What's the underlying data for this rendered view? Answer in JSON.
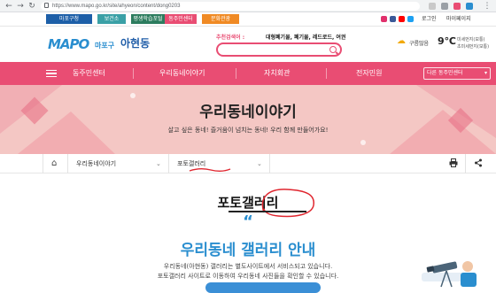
{
  "browser": {
    "url": "https://www.mapo.go.kr/site/ahyeon/content/dong0203"
  },
  "top_strip": {
    "tabs": [
      {
        "label": "마포구청",
        "color": "#1d5fa8"
      },
      {
        "label": "보건소",
        "color": "#3aa0a6"
      },
      {
        "label": "평생학습포털",
        "color": "#2c7c5e"
      },
      {
        "label": "동주민센터",
        "color": "#e94d73"
      },
      {
        "label": "문화관광",
        "color": "#f08a24"
      }
    ],
    "utility": [
      "로그인",
      "마이페이지"
    ]
  },
  "header": {
    "logo_mark": "MAPO",
    "logo_gu": "마포구",
    "logo_dong": "아현동",
    "recommend_label": "추천검색어 :",
    "recommend_words": "대형폐기물, 폐기물, 레드로드, 여권",
    "search_placeholder": "",
    "weather_state": "구름많음",
    "weather_temp": "9℃",
    "air_quality_1": "미세먼지(보통)",
    "air_quality_2": "초미세먼지(보통)"
  },
  "gnb": {
    "items": [
      "동주민센터",
      "우리동네이야기",
      "자치회관",
      "전자민원"
    ],
    "select_label": "다른 동주민센터"
  },
  "hero": {
    "title": "우리동네이야기",
    "subtitle": "살고 싶은 동네! 즐거움이 넘치는 동네! 우리 함께 만들어가요!"
  },
  "breadcrumb": {
    "items": [
      "우리동네이야기",
      "포토갤러리"
    ]
  },
  "content": {
    "page_title": "포토갤러리",
    "quote_mark": "“",
    "gallery_title": "우리동네 갤러리 안내",
    "desc_line1": "우리동네(아현동) 갤러리는 별도사이트에서 서비스되고 있습니다.",
    "desc_line2": "포토갤러리 사이트로 이동하여 우리동네 사진들을 확인할 수 있습니다."
  },
  "colors": {
    "accent_pink": "#e94d73",
    "brand_blue": "#2a8ecf",
    "hero_bg": "#f4c7c4",
    "annotation_red": "#e0262f"
  }
}
